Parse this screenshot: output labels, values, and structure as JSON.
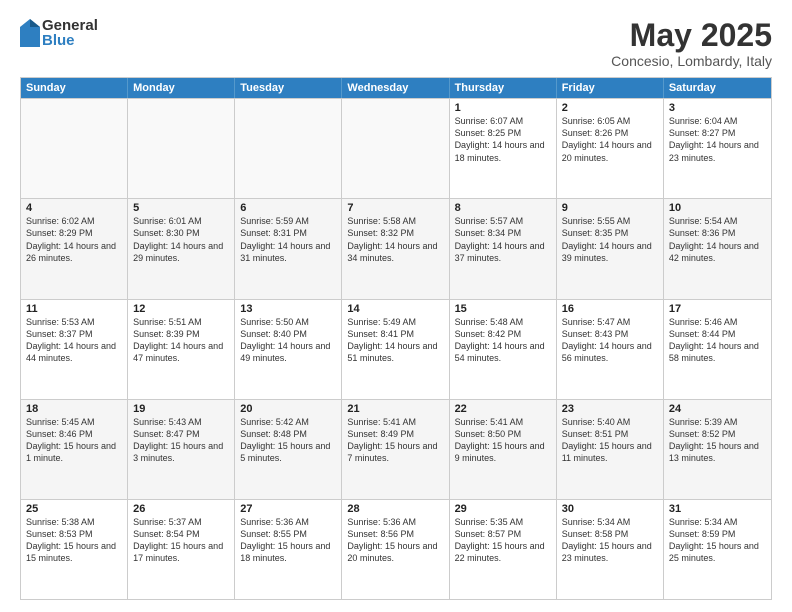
{
  "logo": {
    "general": "General",
    "blue": "Blue"
  },
  "title": "May 2025",
  "location": "Concesio, Lombardy, Italy",
  "days": [
    "Sunday",
    "Monday",
    "Tuesday",
    "Wednesday",
    "Thursday",
    "Friday",
    "Saturday"
  ],
  "weeks": [
    [
      {
        "day": "",
        "empty": true
      },
      {
        "day": "",
        "empty": true
      },
      {
        "day": "",
        "empty": true
      },
      {
        "day": "",
        "empty": true
      },
      {
        "day": "1",
        "sunrise": "6:07 AM",
        "sunset": "8:25 PM",
        "daylight": "14 hours and 18 minutes."
      },
      {
        "day": "2",
        "sunrise": "6:05 AM",
        "sunset": "8:26 PM",
        "daylight": "14 hours and 20 minutes."
      },
      {
        "day": "3",
        "sunrise": "6:04 AM",
        "sunset": "8:27 PM",
        "daylight": "14 hours and 23 minutes."
      }
    ],
    [
      {
        "day": "4",
        "sunrise": "6:02 AM",
        "sunset": "8:29 PM",
        "daylight": "14 hours and 26 minutes."
      },
      {
        "day": "5",
        "sunrise": "6:01 AM",
        "sunset": "8:30 PM",
        "daylight": "14 hours and 29 minutes."
      },
      {
        "day": "6",
        "sunrise": "5:59 AM",
        "sunset": "8:31 PM",
        "daylight": "14 hours and 31 minutes."
      },
      {
        "day": "7",
        "sunrise": "5:58 AM",
        "sunset": "8:32 PM",
        "daylight": "14 hours and 34 minutes."
      },
      {
        "day": "8",
        "sunrise": "5:57 AM",
        "sunset": "8:34 PM",
        "daylight": "14 hours and 37 minutes."
      },
      {
        "day": "9",
        "sunrise": "5:55 AM",
        "sunset": "8:35 PM",
        "daylight": "14 hours and 39 minutes."
      },
      {
        "day": "10",
        "sunrise": "5:54 AM",
        "sunset": "8:36 PM",
        "daylight": "14 hours and 42 minutes."
      }
    ],
    [
      {
        "day": "11",
        "sunrise": "5:53 AM",
        "sunset": "8:37 PM",
        "daylight": "14 hours and 44 minutes."
      },
      {
        "day": "12",
        "sunrise": "5:51 AM",
        "sunset": "8:39 PM",
        "daylight": "14 hours and 47 minutes."
      },
      {
        "day": "13",
        "sunrise": "5:50 AM",
        "sunset": "8:40 PM",
        "daylight": "14 hours and 49 minutes."
      },
      {
        "day": "14",
        "sunrise": "5:49 AM",
        "sunset": "8:41 PM",
        "daylight": "14 hours and 51 minutes."
      },
      {
        "day": "15",
        "sunrise": "5:48 AM",
        "sunset": "8:42 PM",
        "daylight": "14 hours and 54 minutes."
      },
      {
        "day": "16",
        "sunrise": "5:47 AM",
        "sunset": "8:43 PM",
        "daylight": "14 hours and 56 minutes."
      },
      {
        "day": "17",
        "sunrise": "5:46 AM",
        "sunset": "8:44 PM",
        "daylight": "14 hours and 58 minutes."
      }
    ],
    [
      {
        "day": "18",
        "sunrise": "5:45 AM",
        "sunset": "8:46 PM",
        "daylight": "15 hours and 1 minute."
      },
      {
        "day": "19",
        "sunrise": "5:43 AM",
        "sunset": "8:47 PM",
        "daylight": "15 hours and 3 minutes."
      },
      {
        "day": "20",
        "sunrise": "5:42 AM",
        "sunset": "8:48 PM",
        "daylight": "15 hours and 5 minutes."
      },
      {
        "day": "21",
        "sunrise": "5:41 AM",
        "sunset": "8:49 PM",
        "daylight": "15 hours and 7 minutes."
      },
      {
        "day": "22",
        "sunrise": "5:41 AM",
        "sunset": "8:50 PM",
        "daylight": "15 hours and 9 minutes."
      },
      {
        "day": "23",
        "sunrise": "5:40 AM",
        "sunset": "8:51 PM",
        "daylight": "15 hours and 11 minutes."
      },
      {
        "day": "24",
        "sunrise": "5:39 AM",
        "sunset": "8:52 PM",
        "daylight": "15 hours and 13 minutes."
      }
    ],
    [
      {
        "day": "25",
        "sunrise": "5:38 AM",
        "sunset": "8:53 PM",
        "daylight": "15 hours and 15 minutes."
      },
      {
        "day": "26",
        "sunrise": "5:37 AM",
        "sunset": "8:54 PM",
        "daylight": "15 hours and 17 minutes."
      },
      {
        "day": "27",
        "sunrise": "5:36 AM",
        "sunset": "8:55 PM",
        "daylight": "15 hours and 18 minutes."
      },
      {
        "day": "28",
        "sunrise": "5:36 AM",
        "sunset": "8:56 PM",
        "daylight": "15 hours and 20 minutes."
      },
      {
        "day": "29",
        "sunrise": "5:35 AM",
        "sunset": "8:57 PM",
        "daylight": "15 hours and 22 minutes."
      },
      {
        "day": "30",
        "sunrise": "5:34 AM",
        "sunset": "8:58 PM",
        "daylight": "15 hours and 23 minutes."
      },
      {
        "day": "31",
        "sunrise": "5:34 AM",
        "sunset": "8:59 PM",
        "daylight": "15 hours and 25 minutes."
      }
    ]
  ]
}
